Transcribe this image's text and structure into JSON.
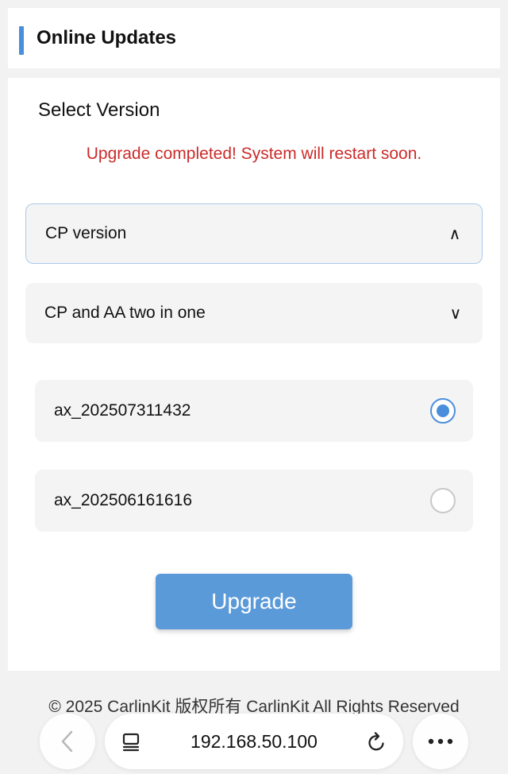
{
  "header": {
    "title": "Online Updates"
  },
  "main": {
    "section_label": "Select Version",
    "status_message": "Upgrade completed! System will restart soon.",
    "accordions": [
      {
        "label": "CP version",
        "state": "expanded",
        "chevron": "∧"
      },
      {
        "label": "CP and AA two in one",
        "state": "collapsed",
        "chevron": "∨"
      }
    ],
    "versions": [
      {
        "label": "ax_202507311432",
        "selected": true
      },
      {
        "label": "ax_202506161616",
        "selected": false
      }
    ],
    "upgrade_label": "Upgrade"
  },
  "footer": {
    "copyright": "© 2025 CarlinKit 版权所有 CarlinKit All Rights Reserved"
  },
  "browser": {
    "url": "192.168.50.100",
    "icons": [
      "back-arrow-icon",
      "tabs-icon",
      "reload-icon",
      "more-icon"
    ]
  },
  "colors": {
    "accent": "#4a8fdb",
    "button": "#5b9ad9",
    "status": "#cc2a2a"
  }
}
